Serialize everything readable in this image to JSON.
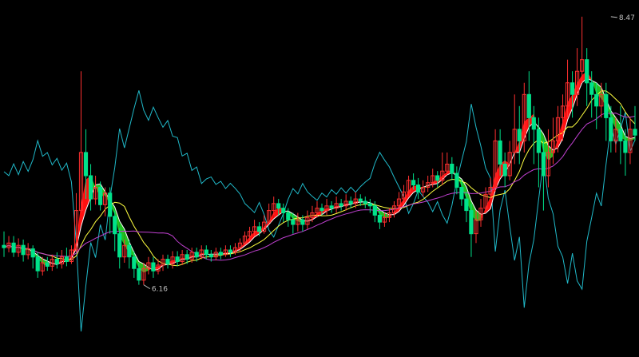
{
  "chart_data": {
    "type": "candlestick",
    "ylim": [
      5.6,
      8.6
    ],
    "annotations": {
      "high": {
        "label": "8.47",
        "value": 8.47,
        "index": 126
      },
      "low": {
        "label": "6.16",
        "value": 6.16,
        "index": 29
      }
    },
    "colors": {
      "background": "#000000",
      "up": "#ff3030",
      "down": "#00e28a",
      "ma_short": "#ffffff",
      "ma_mid": "#ffff40",
      "ma_long": "#c040d0",
      "band_up": "#ff1010",
      "band_down": "#20c020",
      "oscillator": "#20b8c8",
      "annotation": "#c0c0c0"
    },
    "candles": [
      [
        6.5,
        6.48,
        6.62,
        6.4
      ],
      [
        6.48,
        6.52,
        6.58,
        6.44
      ],
      [
        6.52,
        6.44,
        6.58,
        6.4
      ],
      [
        6.44,
        6.5,
        6.56,
        6.4
      ],
      [
        6.5,
        6.42,
        6.55,
        6.36
      ],
      [
        6.42,
        6.47,
        6.52,
        6.38
      ],
      [
        6.47,
        6.4,
        6.5,
        6.3
      ],
      [
        6.4,
        6.28,
        6.44,
        6.22
      ],
      [
        6.28,
        6.35,
        6.4,
        6.24
      ],
      [
        6.35,
        6.32,
        6.4,
        6.28
      ],
      [
        6.32,
        6.38,
        6.42,
        6.28
      ],
      [
        6.38,
        6.34,
        6.44,
        6.3
      ],
      [
        6.34,
        6.4,
        6.46,
        6.3
      ],
      [
        6.4,
        6.36,
        6.48,
        6.32
      ],
      [
        6.36,
        6.46,
        6.5,
        6.34
      ],
      [
        6.46,
        6.8,
        6.95,
        6.44
      ],
      [
        6.8,
        7.3,
        8.0,
        6.78
      ],
      [
        7.3,
        7.1,
        7.5,
        6.9
      ],
      [
        7.1,
        6.9,
        7.2,
        6.8
      ],
      [
        6.9,
        7.0,
        7.1,
        6.85
      ],
      [
        7.0,
        6.85,
        7.05,
        6.8
      ],
      [
        6.85,
        6.95,
        7.0,
        6.75
      ],
      [
        6.95,
        6.75,
        7.0,
        6.6
      ],
      [
        6.75,
        6.6,
        6.8,
        6.45
      ],
      [
        6.6,
        6.4,
        6.65,
        6.3
      ],
      [
        6.4,
        6.5,
        6.55,
        6.35
      ],
      [
        6.5,
        6.4,
        6.55,
        6.3
      ],
      [
        6.4,
        6.3,
        6.45,
        6.22
      ],
      [
        6.3,
        6.2,
        6.35,
        6.16
      ],
      [
        6.2,
        6.3,
        6.35,
        6.16
      ],
      [
        6.3,
        6.35,
        6.4,
        6.25
      ],
      [
        6.35,
        6.28,
        6.4,
        6.22
      ],
      [
        6.28,
        6.33,
        6.38,
        6.25
      ],
      [
        6.33,
        6.38,
        6.42,
        6.28
      ],
      [
        6.38,
        6.34,
        6.42,
        6.3
      ],
      [
        6.34,
        6.4,
        6.45,
        6.3
      ],
      [
        6.4,
        6.36,
        6.45,
        6.32
      ],
      [
        6.36,
        6.42,
        6.46,
        6.33
      ],
      [
        6.42,
        6.38,
        6.46,
        6.34
      ],
      [
        6.38,
        6.44,
        6.48,
        6.35
      ],
      [
        6.44,
        6.4,
        6.48,
        6.36
      ],
      [
        6.4,
        6.46,
        6.5,
        6.38
      ],
      [
        6.46,
        6.42,
        6.5,
        6.38
      ],
      [
        6.42,
        6.4,
        6.46,
        6.36
      ],
      [
        6.4,
        6.44,
        6.48,
        6.37
      ],
      [
        6.44,
        6.42,
        6.48,
        6.38
      ],
      [
        6.42,
        6.46,
        6.5,
        6.4
      ],
      [
        6.46,
        6.44,
        6.5,
        6.4
      ],
      [
        6.44,
        6.48,
        6.52,
        6.42
      ],
      [
        6.48,
        6.52,
        6.56,
        6.44
      ],
      [
        6.52,
        6.58,
        6.62,
        6.5
      ],
      [
        6.58,
        6.62,
        6.66,
        6.54
      ],
      [
        6.62,
        6.66,
        6.72,
        6.58
      ],
      [
        6.66,
        6.62,
        6.7,
        6.58
      ],
      [
        6.62,
        6.7,
        6.76,
        6.6
      ],
      [
        6.7,
        6.8,
        6.86,
        6.68
      ],
      [
        6.8,
        6.86,
        6.92,
        6.76
      ],
      [
        6.86,
        6.82,
        6.9,
        6.76
      ],
      [
        6.82,
        6.78,
        6.86,
        6.7
      ],
      [
        6.78,
        6.72,
        6.82,
        6.66
      ],
      [
        6.72,
        6.68,
        6.78,
        6.6
      ],
      [
        6.68,
        6.72,
        6.78,
        6.62
      ],
      [
        6.72,
        6.68,
        6.76,
        6.62
      ],
      [
        6.68,
        6.74,
        6.8,
        6.64
      ],
      [
        6.74,
        6.78,
        6.84,
        6.7
      ],
      [
        6.78,
        6.82,
        6.88,
        6.74
      ],
      [
        6.82,
        6.8,
        6.86,
        6.76
      ],
      [
        6.8,
        6.84,
        6.9,
        6.76
      ],
      [
        6.84,
        6.82,
        6.88,
        6.78
      ],
      [
        6.82,
        6.86,
        6.92,
        6.78
      ],
      [
        6.86,
        6.84,
        6.9,
        6.8
      ],
      [
        6.84,
        6.88,
        6.94,
        6.8
      ],
      [
        6.88,
        6.86,
        6.92,
        6.82
      ],
      [
        6.86,
        6.9,
        6.96,
        6.82
      ],
      [
        6.9,
        6.88,
        6.94,
        6.84
      ],
      [
        6.88,
        6.86,
        6.92,
        6.82
      ],
      [
        6.86,
        6.84,
        6.9,
        6.78
      ],
      [
        6.84,
        6.76,
        6.88,
        6.7
      ],
      [
        6.76,
        6.7,
        6.8,
        6.64
      ],
      [
        6.7,
        6.74,
        6.78,
        6.66
      ],
      [
        6.74,
        6.78,
        6.82,
        6.7
      ],
      [
        6.78,
        6.84,
        6.88,
        6.74
      ],
      [
        6.84,
        6.9,
        6.96,
        6.8
      ],
      [
        6.9,
        6.96,
        7.02,
        6.86
      ],
      [
        6.96,
        7.06,
        7.1,
        6.92
      ],
      [
        7.06,
        7.02,
        7.12,
        6.98
      ],
      [
        7.02,
        6.96,
        7.08,
        6.9
      ],
      [
        6.96,
        7.0,
        7.06,
        6.92
      ],
      [
        7.0,
        7.04,
        7.1,
        6.96
      ],
      [
        7.04,
        7.1,
        7.16,
        7.0
      ],
      [
        7.1,
        7.06,
        7.14,
        7.0
      ],
      [
        7.06,
        7.14,
        7.3,
        7.02
      ],
      [
        7.14,
        7.2,
        7.3,
        7.1
      ],
      [
        7.2,
        7.12,
        7.26,
        7.06
      ],
      [
        7.12,
        7.0,
        7.18,
        6.94
      ],
      [
        7.0,
        6.9,
        7.06,
        6.84
      ],
      [
        6.9,
        6.8,
        6.96,
        6.7
      ],
      [
        6.8,
        6.6,
        6.86,
        6.4
      ],
      [
        6.6,
        6.72,
        6.8,
        6.52
      ],
      [
        6.72,
        6.82,
        6.9,
        6.66
      ],
      [
        6.82,
        6.94,
        7.0,
        6.78
      ],
      [
        6.94,
        7.0,
        7.08,
        6.9
      ],
      [
        7.0,
        7.4,
        7.5,
        6.96
      ],
      [
        7.4,
        7.2,
        7.5,
        7.1
      ],
      [
        7.2,
        7.1,
        7.3,
        7.0
      ],
      [
        7.1,
        7.3,
        7.4,
        7.06
      ],
      [
        7.3,
        7.5,
        7.8,
        7.2
      ],
      [
        7.5,
        7.4,
        7.7,
        7.2
      ],
      [
        7.4,
        7.8,
        7.9,
        7.3
      ],
      [
        7.8,
        7.6,
        8.0,
        7.4
      ],
      [
        7.6,
        7.5,
        7.7,
        7.2
      ],
      [
        7.5,
        7.3,
        7.6,
        7.0
      ],
      [
        7.3,
        7.1,
        7.4,
        6.8
      ],
      [
        7.1,
        7.3,
        7.5,
        7.0
      ],
      [
        7.3,
        7.4,
        7.6,
        7.2
      ],
      [
        7.4,
        7.6,
        7.7,
        7.3
      ],
      [
        7.6,
        7.7,
        7.8,
        7.4
      ],
      [
        7.7,
        7.9,
        8.1,
        7.6
      ],
      [
        7.9,
        7.8,
        8.0,
        7.6
      ],
      [
        7.8,
        8.0,
        8.2,
        7.7
      ],
      [
        8.0,
        8.1,
        8.47,
        7.9
      ],
      [
        8.1,
        7.9,
        8.2,
        7.7
      ],
      [
        7.9,
        7.8,
        8.0,
        7.6
      ],
      [
        7.8,
        7.7,
        7.9,
        7.5
      ],
      [
        7.7,
        7.8,
        7.9,
        7.6
      ],
      [
        7.8,
        7.6,
        7.9,
        7.4
      ],
      [
        7.6,
        7.4,
        7.7,
        7.3
      ],
      [
        7.4,
        7.5,
        7.6,
        7.3
      ],
      [
        7.5,
        7.4,
        7.7,
        7.2
      ],
      [
        7.4,
        7.3,
        7.5,
        7.1
      ],
      [
        7.3,
        7.5,
        7.6,
        7.2
      ],
      [
        7.5,
        7.45,
        7.7,
        7.4
      ]
    ]
  }
}
